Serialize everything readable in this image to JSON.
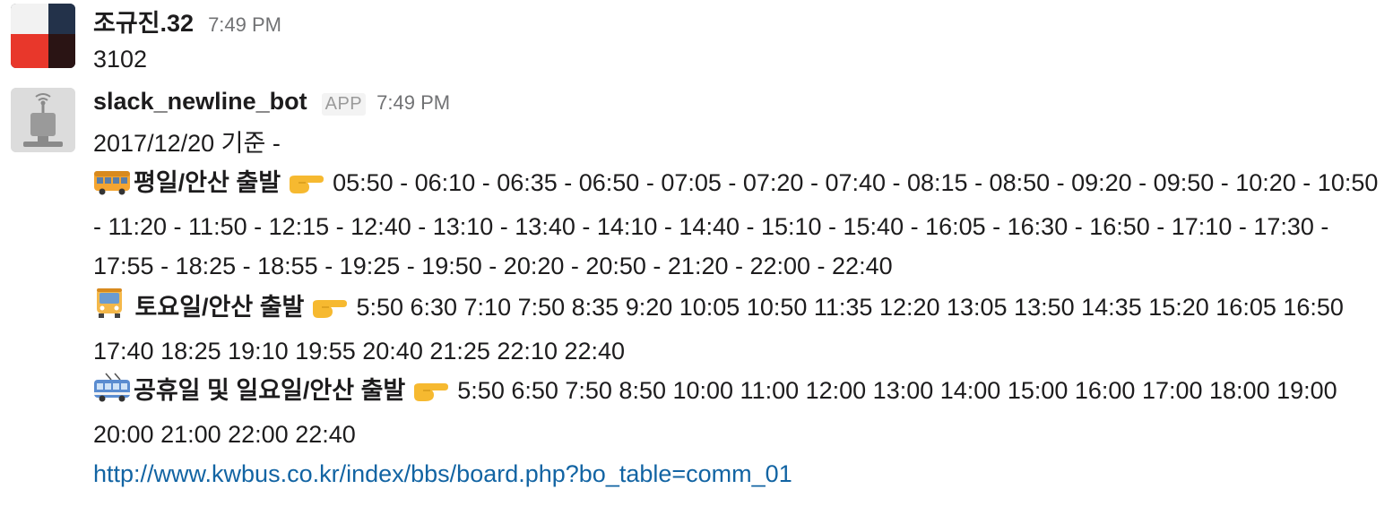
{
  "messages": [
    {
      "author": "조규진.32",
      "time": "7:49 PM",
      "text": "3102"
    },
    {
      "author": "slack_newline_bot",
      "badge": "APP",
      "time": "7:49 PM",
      "intro": "2017/12/20 기준 -",
      "schedules": [
        {
          "icon": "bus-icon",
          "label": "평일/안산 출발",
          "times": "05:50 - 06:10 - 06:35 - 06:50 - 07:05 - 07:20 - 07:40 - 08:15 - 08:50 - 09:20 - 09:50 - 10:20 - 10:50 - 11:20 - 11:50 - 12:15 - 12:40 - 13:10 - 13:40 - 14:10 - 14:40 - 15:10 - 15:40 - 16:05 - 16:30 - 16:50 - 17:10 - 17:30 - 17:55 - 18:25 - 18:55 - 19:25 - 19:50 - 20:20 - 20:50 - 21:20 - 22:00 - 22:40"
        },
        {
          "icon": "oncoming-bus-icon",
          "label": "토요일/안산 출발",
          "times": "5:50 6:30 7:10 7:50 8:35 9:20 10:05 10:50 11:35 12:20 13:05 13:50 14:35 15:20 16:05 16:50 17:40 18:25 19:10 19:55 20:40 21:25 22:10 22:40"
        },
        {
          "icon": "trolleybus-icon",
          "label": "공휴일 및 일요일/안산 출발",
          "times": "5:50 6:50 7:50 8:50 10:00 11:00 12:00 13:00 14:00 15:00 16:00 17:00 18:00 19:00 20:00 21:00 22:00 22:40"
        }
      ],
      "pointer_icon": "pointing-right-icon",
      "link": "http://www.kwbus.co.kr/index/bbs/board.php?bo_table=comm_01"
    }
  ],
  "colors": {
    "link": "#1264a3",
    "timestamp": "#717274",
    "text": "#1d1c1d"
  }
}
